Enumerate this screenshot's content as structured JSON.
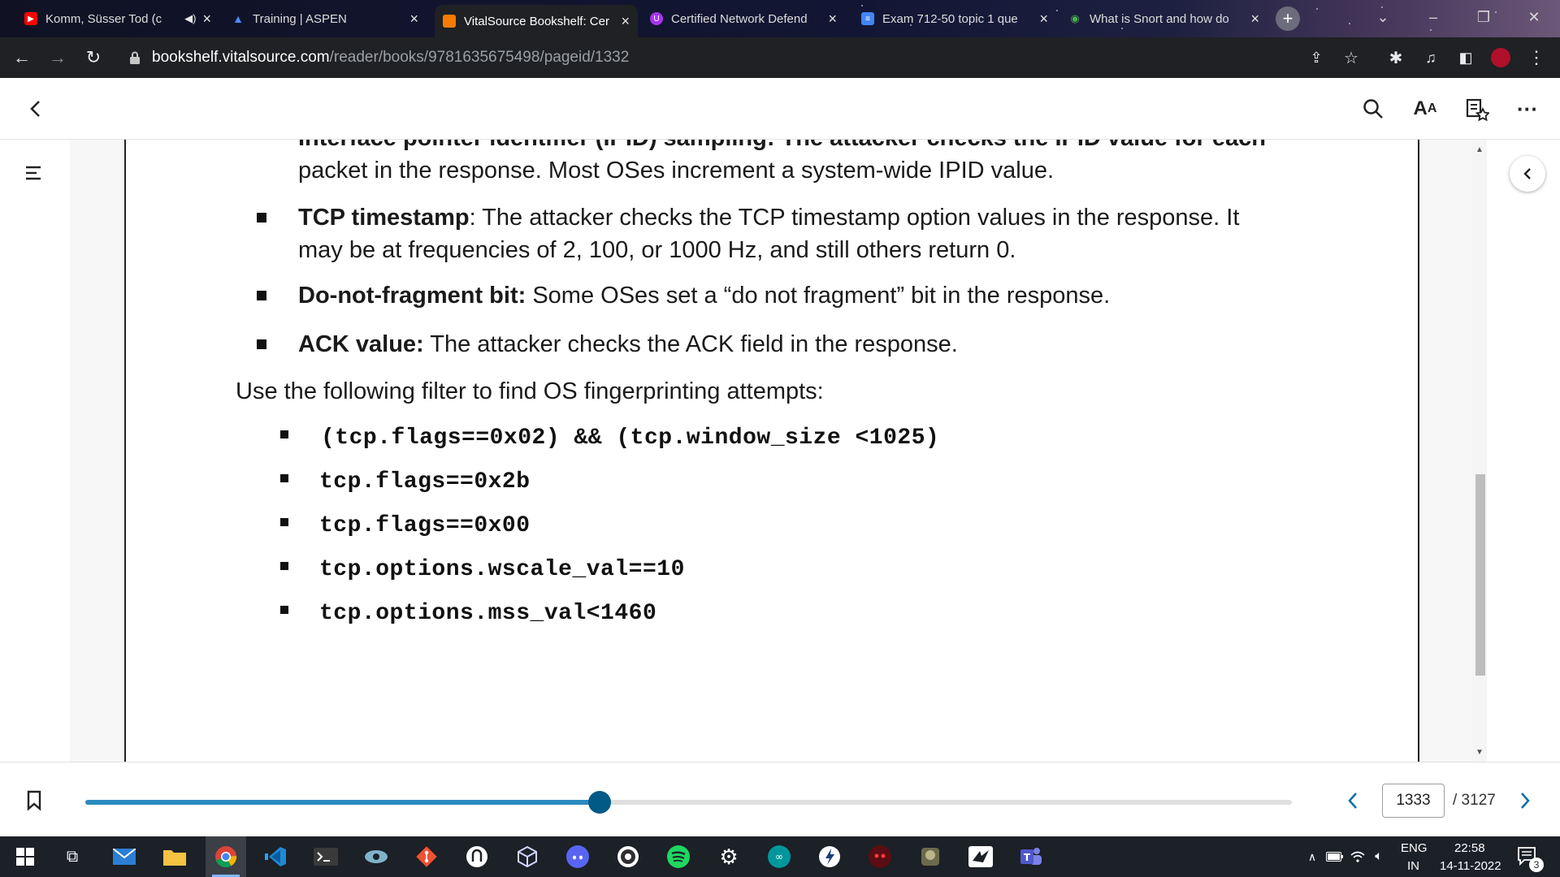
{
  "browser": {
    "tabs": [
      {
        "title": "Komm, Süsser Tod (c",
        "favicon": "youtube-icon",
        "favicon_color": "#ff0000",
        "muted_icon": "speaker-icon",
        "active": false
      },
      {
        "title": "Training | ASPEN",
        "favicon": "aspen-icon",
        "favicon_color": "#1a73e8",
        "active": false
      },
      {
        "title": "VitalSource Bookshelf: Cer",
        "favicon": "vitalsource-icon",
        "favicon_color": "#f57c00",
        "active": true
      },
      {
        "title": "Certified Network Defend",
        "favicon": "udemy-icon",
        "favicon_color": "#a435f0",
        "active": false
      },
      {
        "title": "Exam 712-50 topic 1 que",
        "favicon": "examtopics-icon",
        "favicon_color": "#4285f4",
        "active": false
      },
      {
        "title": "What is Snort and how do",
        "favicon": "snort-icon",
        "favicon_color": "#2e7d32",
        "active": false
      }
    ],
    "url_host": "bookshelf.vitalsource.com",
    "url_path": "/reader/books/9781635675498/pageid/1332"
  },
  "book": {
    "line_partial_top": "Interface pointer identifier (IPID) sampling: The attacker checks the IPID value for each",
    "line_partial_cont": "packet in the response. Most OSes increment a system-wide IPID value.",
    "bullet_tcp_label": "TCP timestamp",
    "bullet_tcp_text_1": ": The attacker checks the TCP timestamp option values in the response. It",
    "bullet_tcp_text_2": "may be at frequencies of 2, 100, or 1000 Hz, and still others return 0.",
    "bullet_df_label": "Do-not-fragment bit:",
    "bullet_df_text": " Some OSes set a “do not fragment” bit in the response.",
    "bullet_ack_label": "ACK value:",
    "bullet_ack_text": " The attacker checks the ACK field in the response.",
    "filter_intro": "Use the following filter to find OS fingerprinting attempts:",
    "filters": [
      "(tcp.flags==0x02) && (tcp.window_size <1025)",
      "tcp.flags==0x2b",
      "tcp.flags==0x00",
      "tcp.options.wscale_val==10",
      "tcp.options.mss_val<1460"
    ]
  },
  "reader": {
    "current_page": "1333",
    "total_pages": "/ 3127",
    "progress_fraction": 0.426,
    "accent_color": "#2a8bbf"
  },
  "taskbar": {
    "language_line1": "ENG",
    "language_line2": "IN",
    "time": "22:58",
    "date": "14-11-2022",
    "notification_count": "3"
  }
}
